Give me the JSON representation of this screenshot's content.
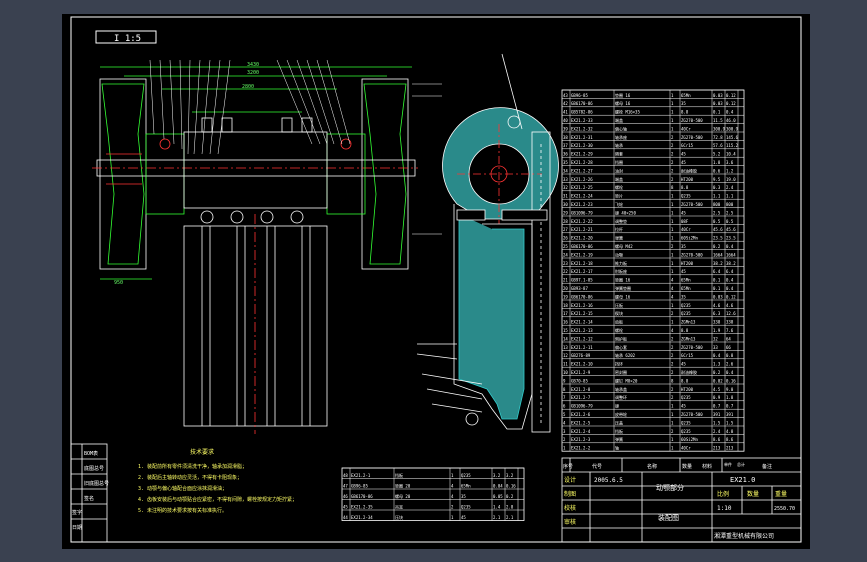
{
  "view_label": "I 1:5",
  "dims": {
    "top_width": "3430",
    "inner_width": "3200",
    "span": "2800",
    "height": "950"
  },
  "notes": {
    "title": "技术要求",
    "lines": [
      "1. 装配前所有零件须清洗干净，轴承加润滑脂；",
      "2. 装配后主轴转动应灵活，不得有卡阻现象；",
      "3. 动颚与偏心轴配合面应涂抹润滑油；",
      "4. 齿板安装后与动颚贴合应紧密，不得有间隙，螺栓按规定力矩拧紧；",
      "5. 未注明的技术要求按有关标准执行。"
    ]
  },
  "title_block": {
    "drawing_no": "EX21.0",
    "part_name": "动颚部分",
    "date": "2005.6.5",
    "scale": "1:10",
    "weight": "2550.70",
    "company": "湘潭重型机械有限公司",
    "drawing_title": "装配图",
    "labels": {
      "design": "设计",
      "draw": "制图",
      "check": "校核",
      "review": "审核",
      "scale": "比例",
      "quantity": "数量",
      "weight": "重量",
      "seq": "序号",
      "code": "代号",
      "name": "名称",
      "qty": "数量",
      "material": "材料",
      "single": "单件",
      "total": "总计",
      "remark": "备注"
    }
  },
  "sheet_labels": {
    "sign": "签字",
    "date": "日期",
    "marks": [
      "BOM表",
      "底图总号",
      "旧底图总号",
      "签名"
    ]
  },
  "parts": [
    [
      "43",
      "GB96-85",
      "垫圈 16",
      "1",
      "65Mn",
      "0.03",
      "0.12",
      ""
    ],
    [
      "42",
      "GB6170-86",
      "螺母 16",
      "1",
      "35",
      "0.03",
      "0.12",
      ""
    ],
    [
      "41",
      "GB5782-86",
      "螺栓 M16×35",
      "1",
      "8.8",
      "0.1",
      "0.4",
      ""
    ],
    [
      "40",
      "EX21.2-33",
      "端盖",
      "1",
      "ZG270-500",
      "11.5",
      "46.0",
      ""
    ],
    [
      "39",
      "EX21.2-32",
      "偏心轴",
      "1",
      "40Cr",
      "300.9",
      "300.9",
      ""
    ],
    [
      "38",
      "EX21.2-31",
      "轴承座",
      "2",
      "ZG270-500",
      "72.8",
      "145.6",
      ""
    ],
    [
      "37",
      "EX21.2-30",
      "轴承",
      "2",
      "GCr15",
      "57.6",
      "115.2",
      ""
    ],
    [
      "36",
      "EX21.2-29",
      "隔套",
      "2",
      "45",
      "5.2",
      "10.4",
      ""
    ],
    [
      "35",
      "EX21.2-28",
      "挡圈",
      "2",
      "45",
      "1.8",
      "3.6",
      ""
    ],
    [
      "34",
      "EX21.2-27",
      "油封",
      "2",
      "耐油橡胶",
      "0.6",
      "1.2",
      ""
    ],
    [
      "33",
      "EX21.2-26",
      "端盖",
      "2",
      "HT200",
      "9.5",
      "19.0",
      ""
    ],
    [
      "32",
      "EX21.2-25",
      "螺栓",
      "8",
      "8.8",
      "0.3",
      "2.4",
      ""
    ],
    [
      "31",
      "EX21.2-24",
      "垫片",
      "1",
      "Q235",
      "1.1",
      "1.1",
      ""
    ],
    [
      "30",
      "EX21.2-23",
      "飞轮",
      "1",
      "ZG270-500",
      "800",
      "800",
      ""
    ],
    [
      "29",
      "GB1096-79",
      "键 40×250",
      "1",
      "45",
      "2.5",
      "2.5",
      ""
    ],
    [
      "28",
      "EX21.2-22",
      "调整垫",
      "1",
      "08F",
      "0.5",
      "0.5",
      ""
    ],
    [
      "27",
      "EX21.2-21",
      "拉杆",
      "1",
      "40Cr",
      "45.6",
      "45.6",
      ""
    ],
    [
      "26",
      "EX21.2-20",
      "弹簧",
      "1",
      "60Si2Mn",
      "23.5",
      "23.5",
      ""
    ],
    [
      "25",
      "GB6170-86",
      "螺母 M42",
      "2",
      "35",
      "0.2",
      "0.4",
      ""
    ],
    [
      "24",
      "EX21.2-19",
      "动颚",
      "1",
      "ZG270-500",
      "1664",
      "1664",
      ""
    ],
    [
      "23",
      "EX21.2-18",
      "推力板",
      "1",
      "HT200",
      "38.2",
      "38.2",
      ""
    ],
    [
      "22",
      "EX21.2-17",
      "肘板座",
      "1",
      "45",
      "6.4",
      "6.4",
      ""
    ],
    [
      "21",
      "GB97.1-85",
      "垫圈 16",
      "4",
      "65Mn",
      "0.1",
      "0.4",
      ""
    ],
    [
      "20",
      "GB93-87",
      "弹簧垫圈",
      "4",
      "65Mn",
      "0.1",
      "0.4",
      ""
    ],
    [
      "19",
      "GB6170-86",
      "螺母 16",
      "4",
      "35",
      "0.03",
      "0.12",
      ""
    ],
    [
      "18",
      "EX21.2-16",
      "压板",
      "1",
      "Q235",
      "4.6",
      "4.6",
      ""
    ],
    [
      "17",
      "EX21.2-15",
      "楔块",
      "2",
      "Q235",
      "6.3",
      "12.6",
      ""
    ],
    [
      "16",
      "EX21.2-14",
      "齿板",
      "1",
      "ZGMn13",
      "338",
      "338",
      ""
    ],
    [
      "15",
      "EX21.2-13",
      "螺栓",
      "4",
      "8.8",
      "1.9",
      "7.6",
      ""
    ],
    [
      "14",
      "EX21.2-12",
      "侧护板",
      "2",
      "ZGMn13",
      "32",
      "64",
      ""
    ],
    [
      "13",
      "EX21.2-11",
      "偏心套",
      "2",
      "ZG270-500",
      "33",
      "66",
      ""
    ],
    [
      "12",
      "GB276-89",
      "轴承 6202",
      "2",
      "GCr15",
      "0.4",
      "0.8",
      ""
    ],
    [
      "11",
      "EX21.2-10",
      "挡环",
      "2",
      "45",
      "1.3",
      "2.6",
      ""
    ],
    [
      "10",
      "EX21.2-9",
      "密封圈",
      "2",
      "耐油橡胶",
      "0.2",
      "0.4",
      ""
    ],
    [
      "9",
      "GB70-85",
      "螺钉 M8×20",
      "8",
      "8.8",
      "0.02",
      "0.16",
      ""
    ],
    [
      "8",
      "EX21.2-8",
      "轴承盖",
      "2",
      "HT200",
      "4.5",
      "9.0",
      ""
    ],
    [
      "7",
      "EX21.2-7",
      "调整环",
      "2",
      "Q235",
      "0.9",
      "1.8",
      ""
    ],
    [
      "6",
      "GB1096-79",
      "键",
      "1",
      "45",
      "0.7",
      "0.7",
      ""
    ],
    [
      "5",
      "EX21.2-6",
      "皮带轮",
      "1",
      "ZG270-500",
      "391",
      "391",
      ""
    ],
    [
      "4",
      "EX21.2-5",
      "压盖",
      "1",
      "Q235",
      "1.5",
      "1.5",
      ""
    ],
    [
      "3",
      "EX21.2-4",
      "挡板",
      "2",
      "Q235",
      "2.4",
      "4.8",
      ""
    ],
    [
      "2",
      "EX21.2-3",
      "弹簧",
      "1",
      "60Si2Mn",
      "8.6",
      "8.6",
      ""
    ],
    [
      "1",
      "EX21.2-2",
      "轴",
      "1",
      "40Cr",
      "213",
      "213",
      ""
    ]
  ],
  "lower_parts": [
    [
      "48",
      "EX21.2-1",
      "挡板",
      "1",
      "Q235",
      "3.2",
      "3.2",
      ""
    ],
    [
      "47",
      "GB96-85",
      "垫圈 20",
      "4",
      "65Mn",
      "0.04",
      "0.16",
      ""
    ],
    [
      "46",
      "GB6170-86",
      "螺母 20",
      "4",
      "35",
      "0.05",
      "0.2",
      ""
    ],
    [
      "45",
      "EX21.2-35",
      "吊耳",
      "2",
      "Q235",
      "1.4",
      "2.8",
      ""
    ],
    [
      "44",
      "EX21.2-34",
      "压块",
      "1",
      "45",
      "2.1",
      "2.1",
      ""
    ]
  ],
  "colors": {
    "sheet": "#000000",
    "frame": "#ffffff",
    "line": "#ffffff",
    "green": "#33ff33",
    "cyan": "#33cccc",
    "red": "#ff3333",
    "yellow": "#ffff66"
  }
}
